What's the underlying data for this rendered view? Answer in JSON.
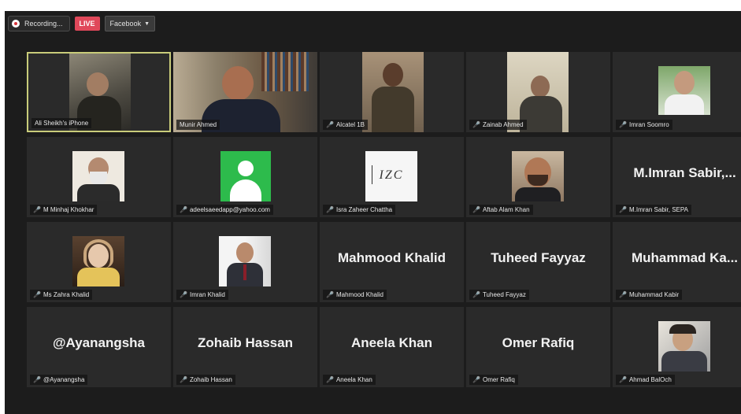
{
  "topbar": {
    "recording_label": "Recording...",
    "live_label": "LIVE",
    "stream_target": "Facebook"
  },
  "icons": {
    "record": "record-dot-icon",
    "dropdown": "chevron-down-icon",
    "mic_muted": "mic-muted-icon"
  },
  "colors": {
    "live": "#e0485a",
    "active_border": "#c9cc7a",
    "muted_mic": "#e34b4b"
  },
  "participants": [
    {
      "label": "Ali Sheikh's iPhone",
      "display": "",
      "active": true
    },
    {
      "label": "Munir Ahmed",
      "display": ""
    },
    {
      "label": "Alcatel 1B",
      "display": ""
    },
    {
      "label": "Zainab Ahmed",
      "display": ""
    },
    {
      "label": "Imran Soomro",
      "display": ""
    },
    {
      "label": "M Minhaj Khokhar",
      "display": ""
    },
    {
      "label": "adeelsaeedapp@yahoo.com",
      "display": ""
    },
    {
      "label": "Isra Zaheer Chattha",
      "display": "IZC"
    },
    {
      "label": "Aftab Alam Khan",
      "display": ""
    },
    {
      "label": "M.Imran Sabir, SEPA",
      "display": "M.Imran  Sabir,..."
    },
    {
      "label": "Ms Zahra Khalid",
      "display": ""
    },
    {
      "label": "Imran Khalid",
      "display": ""
    },
    {
      "label": "Mahmood Khalid",
      "display": "Mahmood Khalid"
    },
    {
      "label": "Tuheed Fayyaz",
      "display": "Tuheed Fayyaz"
    },
    {
      "label": "Muhammad Kabir",
      "display": "Muhammad  Ka..."
    },
    {
      "label": "@Ayanangsha",
      "display": "@Ayanangsha"
    },
    {
      "label": "Zohaib Hassan",
      "display": "Zohaib Hassan"
    },
    {
      "label": "Aneela Khan",
      "display": "Aneela Khan"
    },
    {
      "label": "Omer Rafiq",
      "display": "Omer Rafiq"
    },
    {
      "label": "Ahmad BalOch",
      "display": ""
    }
  ]
}
